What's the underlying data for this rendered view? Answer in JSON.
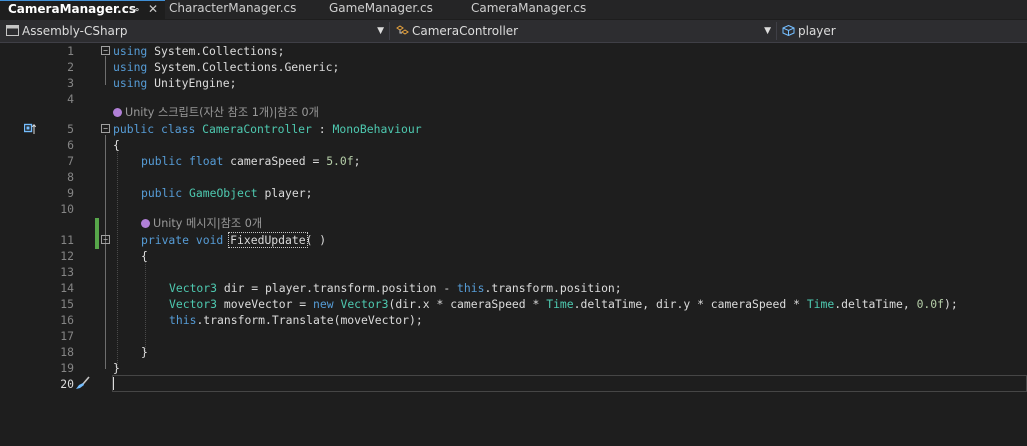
{
  "tabs": [
    {
      "label": "CameraManager.cs",
      "active": true,
      "pin": "⊸",
      "close": "✕"
    },
    {
      "label": "CharacterManager.cs"
    },
    {
      "label": "GameManager.cs"
    },
    {
      "label": "CameraManager.cs"
    }
  ],
  "nav": {
    "project": "Assembly-CSharp",
    "type": "CameraController",
    "member": "player"
  },
  "hints": {
    "class_hint": "Unity 스크립트(자산 참조 1개)|참조 0개",
    "method_hint": "Unity 메시지|참조 0개"
  },
  "code": {
    "l1_using": "using",
    "l1_rest": " System.Collections;",
    "l2_using": "using",
    "l2_rest": " System.Collections.Generic;",
    "l3_using": "using",
    "l3_rest": " UnityEngine;",
    "l5_public": "public",
    "l5_class": "class",
    "l5_name": "CameraController",
    "l5_colon": " : ",
    "l5_base": "MonoBehaviour",
    "l6": "{",
    "l7_public": "public",
    "l7_float": "float",
    "l7_name": " cameraSpeed = ",
    "l7_num": "5.0f",
    "l7_semi": ";",
    "l9_public": "public",
    "l9_type": "GameObject",
    "l9_name": " player;",
    "l11_mods": "private void ",
    "l11_name": "FixedUpdate",
    "l11_parens": "( )",
    "l12": "{",
    "l14_type": "Vector3",
    "l14_a": " dir = player.transform.position - ",
    "l14_this": "this",
    "l14_b": ".transform.position;",
    "l15_type": "Vector3",
    "l15_a": " moveVector = ",
    "l15_new": "new",
    "l15_type2": "Vector3",
    "l15_b": "(dir.x * cameraSpeed * ",
    "l15_time1": "Time",
    "l15_c": ".deltaTime, dir.y * cameraSpeed * ",
    "l15_time2": "Time",
    "l15_d": ".deltaTime, ",
    "l15_num": "0.0f",
    "l15_e": ");",
    "l16_this": "this",
    "l16_rest": ".transform.Translate(moveVector);",
    "l18": "}",
    "l19": "}"
  },
  "line_numbers": [
    "1",
    "2",
    "3",
    "4",
    "5",
    "6",
    "7",
    "8",
    "9",
    "10",
    "11",
    "12",
    "13",
    "14",
    "15",
    "16",
    "17",
    "18",
    "19",
    "20"
  ],
  "colors": {
    "keyword": "#569cd6",
    "type": "#4ec9b0",
    "number": "#b5cea8",
    "text": "#dcdcdc",
    "hint": "#999999",
    "change_bar": "#57a64a"
  },
  "icons": {
    "class_marker": "class-implementation-icon",
    "brush": "quick-action-brush-icon",
    "project": "project-icon",
    "type": "class-icon",
    "member": "field-icon"
  }
}
